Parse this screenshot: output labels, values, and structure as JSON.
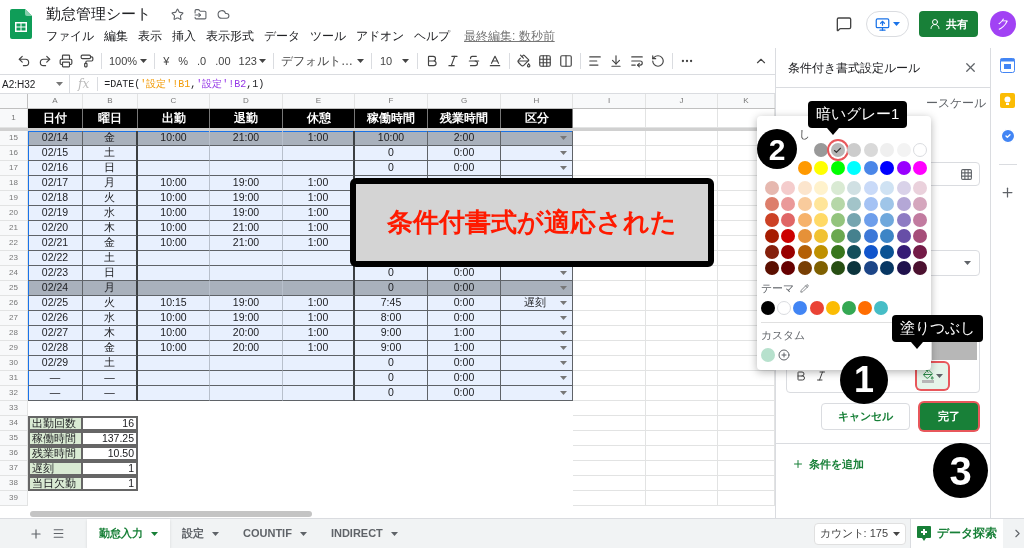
{
  "header": {
    "title": "勤怠管理シート",
    "menu": [
      "ファイル",
      "編集",
      "表示",
      "挿入",
      "表示形式",
      "データ",
      "ツール",
      "アドオン",
      "ヘルプ"
    ],
    "last_edit": "最終編集: 数秒前",
    "share": "共有",
    "avatar": "ク"
  },
  "toolbar": {
    "zoom": "100%",
    "currency": "¥",
    "percent": "%",
    "decrease_decimal": ".0",
    "increase_decimal": ".00",
    "number_format": "123",
    "font": "デフォルト…",
    "font_size": "10"
  },
  "formula_bar": {
    "range": "A2:H32",
    "fx": "fx",
    "formula": [
      {
        "text": "=DATE("
      },
      {
        "text": "'設定'!B1",
        "color": "#f29900"
      },
      {
        "text": ","
      },
      {
        "text": "'設定'!B2",
        "color": "#9334e6"
      },
      {
        "text": ",1)"
      }
    ]
  },
  "sheet": {
    "columns": [
      "A",
      "B",
      "C",
      "D",
      "E",
      "F",
      "G",
      "H",
      "I",
      "J",
      "K"
    ],
    "header_row": {
      "n": "1",
      "titles": [
        "日付",
        "曜日",
        "出勤",
        "退勤",
        "休憩",
        "稼働時間",
        "残業時間",
        "区分"
      ]
    },
    "rows": [
      {
        "n": "15",
        "kind": "data",
        "highlighted": true,
        "dropdown": true,
        "date": "02/14",
        "day": "金",
        "in": "10:00",
        "out": "21:00",
        "rest": "1:00",
        "work": "10:00",
        "over": "2:00"
      },
      {
        "n": "16",
        "kind": "data",
        "highlighted": false,
        "dropdown": true,
        "date": "02/15",
        "day": "土",
        "work": "0",
        "over": "0:00"
      },
      {
        "n": "17",
        "kind": "data",
        "highlighted": false,
        "dropdown": true,
        "date": "02/16",
        "day": "日",
        "work": "0",
        "over": "0:00"
      },
      {
        "n": "18",
        "kind": "data",
        "highlighted": false,
        "date": "02/17",
        "day": "月",
        "in": "10:00",
        "out": "19:00",
        "rest": "1:00"
      },
      {
        "n": "19",
        "kind": "data",
        "highlighted": false,
        "date": "02/18",
        "day": "火",
        "in": "10:00",
        "out": "19:00",
        "rest": "1:00"
      },
      {
        "n": "20",
        "kind": "data",
        "highlighted": false,
        "date": "02/19",
        "day": "水",
        "in": "10:00",
        "out": "19:00",
        "rest": "1:00"
      },
      {
        "n": "21",
        "kind": "data",
        "highlighted": false,
        "date": "02/20",
        "day": "木",
        "in": "10:00",
        "out": "21:00",
        "rest": "1:00"
      },
      {
        "n": "22",
        "kind": "data",
        "highlighted": false,
        "date": "02/21",
        "day": "金",
        "in": "10:00",
        "out": "21:00",
        "rest": "1:00"
      },
      {
        "n": "23",
        "kind": "data",
        "highlighted": false,
        "date": "02/22",
        "day": "土"
      },
      {
        "n": "24",
        "kind": "data",
        "highlighted": false,
        "dropdown": true,
        "date": "02/23",
        "day": "日",
        "work": "0",
        "over": "0:00"
      },
      {
        "n": "25",
        "kind": "data",
        "highlighted": true,
        "dropdown": true,
        "date": "02/24",
        "day": "月",
        "work": "0",
        "over": "0:00"
      },
      {
        "n": "26",
        "kind": "data",
        "highlighted": false,
        "dropdown": true,
        "date": "02/25",
        "day": "火",
        "in": "10:15",
        "out": "19:00",
        "rest": "1:00",
        "work": "7:45",
        "over": "0:00",
        "type": "遅刻"
      },
      {
        "n": "27",
        "kind": "data",
        "highlighted": false,
        "dropdown": true,
        "date": "02/26",
        "day": "水",
        "in": "10:00",
        "out": "19:00",
        "rest": "1:00",
        "work": "8:00",
        "over": "0:00"
      },
      {
        "n": "28",
        "kind": "data",
        "highlighted": false,
        "dropdown": true,
        "date": "02/27",
        "day": "木",
        "in": "10:00",
        "out": "20:00",
        "rest": "1:00",
        "work": "9:00",
        "over": "1:00"
      },
      {
        "n": "29",
        "kind": "data",
        "highlighted": false,
        "dropdown": true,
        "date": "02/28",
        "day": "金",
        "in": "10:00",
        "out": "20:00",
        "rest": "1:00",
        "work": "9:00",
        "over": "1:00"
      },
      {
        "n": "30",
        "kind": "data",
        "highlighted": false,
        "dropdown": true,
        "date": "02/29",
        "day": "土",
        "work": "0",
        "over": "0:00"
      },
      {
        "n": "31",
        "kind": "data",
        "highlighted": false,
        "dropdown": true,
        "date": "—",
        "day": "—",
        "work": "0",
        "over": "0:00"
      },
      {
        "n": "32",
        "kind": "data",
        "highlighted": false,
        "dropdown": true,
        "date": "—",
        "day": "—",
        "work": "0",
        "over": "0:00"
      },
      {
        "n": "33",
        "kind": "blank"
      },
      {
        "n": "34",
        "kind": "summary",
        "label": "出勤回数",
        "value": "16"
      },
      {
        "n": "35",
        "kind": "summary",
        "label": "稼働時間",
        "value": "137.25"
      },
      {
        "n": "36",
        "kind": "summary",
        "label": "残業時間",
        "value": "10.50"
      },
      {
        "n": "37",
        "kind": "summary",
        "label": "遅刻",
        "value": "1"
      },
      {
        "n": "38",
        "kind": "summary",
        "label": "当日欠勤",
        "value": "1"
      },
      {
        "n": "39",
        "kind": "blank"
      }
    ]
  },
  "callout": "条件付書式が適応された",
  "panel": {
    "title": "条件付き書式設定ルール",
    "tab_fragment": "ースケール",
    "fill_button": {
      "color": "#b7b7b7",
      "highlighted": true
    },
    "cancel": "キャンセル",
    "done": {
      "label": "完了",
      "highlighted": true
    },
    "add_condition": "条件を追加"
  },
  "palette": {
    "reset_fragment": "し",
    "rows": [
      {
        "swatches": [
          {
            "color": "#999999",
            "selected": false
          },
          {
            "color": "#b7b7b7",
            "selected": true
          },
          {
            "color": "#cccccc",
            "selected": false
          },
          {
            "color": "#d9d9d9",
            "selected": false
          },
          {
            "color": "#efefef",
            "selected": false
          },
          {
            "color": "#f3f3f3",
            "selected": false
          },
          {
            "color": "#ffffff",
            "selected": false
          }
        ]
      },
      {
        "swatches": [
          {
            "color": "#ff9900",
            "selected": false
          },
          {
            "color": "#ffff00",
            "selected": false
          },
          {
            "color": "#00ff00",
            "selected": false
          },
          {
            "color": "#00ffff",
            "selected": false
          },
          {
            "color": "#4a86e8",
            "selected": false
          },
          {
            "color": "#0000ff",
            "selected": false
          },
          {
            "color": "#9900ff",
            "selected": false
          },
          {
            "color": "#ff00ff",
            "selected": false
          }
        ]
      },
      {
        "swatches": [
          {
            "color": "#e6b8af",
            "selected": false
          },
          {
            "color": "#f4cccc",
            "selected": false
          },
          {
            "color": "#fce5cd",
            "selected": false
          },
          {
            "color": "#fff2cc",
            "selected": false
          },
          {
            "color": "#d9ead3",
            "selected": false
          },
          {
            "color": "#d0e0e3",
            "selected": false
          },
          {
            "color": "#c9daf8",
            "selected": false
          },
          {
            "color": "#cfe2f3",
            "selected": false
          },
          {
            "color": "#d9d2e9",
            "selected": false
          },
          {
            "color": "#ead1dc",
            "selected": false
          }
        ]
      },
      {
        "swatches": [
          {
            "color": "#dd7e6b",
            "selected": false
          },
          {
            "color": "#ea9999",
            "selected": false
          },
          {
            "color": "#f9cb9c",
            "selected": false
          },
          {
            "color": "#ffe599",
            "selected": false
          },
          {
            "color": "#b6d7a8",
            "selected": false
          },
          {
            "color": "#a2c4c9",
            "selected": false
          },
          {
            "color": "#a4c2f4",
            "selected": false
          },
          {
            "color": "#9fc5e8",
            "selected": false
          },
          {
            "color": "#b4a7d6",
            "selected": false
          },
          {
            "color": "#d5a6bd",
            "selected": false
          }
        ]
      },
      {
        "swatches": [
          {
            "color": "#cc4125",
            "selected": false
          },
          {
            "color": "#e06666",
            "selected": false
          },
          {
            "color": "#f6b26b",
            "selected": false
          },
          {
            "color": "#ffd966",
            "selected": false
          },
          {
            "color": "#93c47d",
            "selected": false
          },
          {
            "color": "#76a5af",
            "selected": false
          },
          {
            "color": "#6d9eeb",
            "selected": false
          },
          {
            "color": "#6fa8dc",
            "selected": false
          },
          {
            "color": "#8e7cc3",
            "selected": false
          },
          {
            "color": "#c27ba0",
            "selected": false
          }
        ]
      },
      {
        "swatches": [
          {
            "color": "#a61c00",
            "selected": false
          },
          {
            "color": "#cc0000",
            "selected": false
          },
          {
            "color": "#e69138",
            "selected": false
          },
          {
            "color": "#f1c232",
            "selected": false
          },
          {
            "color": "#6aa84f",
            "selected": false
          },
          {
            "color": "#45818e",
            "selected": false
          },
          {
            "color": "#3c78d8",
            "selected": false
          },
          {
            "color": "#3d85c6",
            "selected": false
          },
          {
            "color": "#674ea7",
            "selected": false
          },
          {
            "color": "#a64d79",
            "selected": false
          }
        ]
      },
      {
        "swatches": [
          {
            "color": "#85200c",
            "selected": false
          },
          {
            "color": "#990000",
            "selected": false
          },
          {
            "color": "#b45f06",
            "selected": false
          },
          {
            "color": "#bf9000",
            "selected": false
          },
          {
            "color": "#38761d",
            "selected": false
          },
          {
            "color": "#134f5c",
            "selected": false
          },
          {
            "color": "#1155cc",
            "selected": false
          },
          {
            "color": "#0b5394",
            "selected": false
          },
          {
            "color": "#351c75",
            "selected": false
          },
          {
            "color": "#741b47",
            "selected": false
          }
        ]
      },
      {
        "swatches": [
          {
            "color": "#5b0f00",
            "selected": false
          },
          {
            "color": "#660000",
            "selected": false
          },
          {
            "color": "#783f04",
            "selected": false
          },
          {
            "color": "#7f6000",
            "selected": false
          },
          {
            "color": "#274e13",
            "selected": false
          },
          {
            "color": "#0c343d",
            "selected": false
          },
          {
            "color": "#1c4587",
            "selected": false
          },
          {
            "color": "#073763",
            "selected": false
          },
          {
            "color": "#20124d",
            "selected": false
          },
          {
            "color": "#4c1130",
            "selected": false
          }
        ]
      }
    ],
    "theme_label": "テーマ",
    "theme": [
      {
        "color": "#000000"
      },
      {
        "color": "#ffffff"
      },
      {
        "color": "#4285f4"
      },
      {
        "color": "#ea4335"
      },
      {
        "color": "#fbbc04"
      },
      {
        "color": "#34a853"
      },
      {
        "color": "#ff6d01"
      },
      {
        "color": "#46bdc6"
      }
    ],
    "custom_label": "カスタム",
    "custom": [
      {
        "color": "#b7e1cd"
      }
    ]
  },
  "tooltips": {
    "swatch": "暗いグレー1",
    "fill": "塗りつぶし"
  },
  "steps": [
    "1",
    "2",
    "3"
  ],
  "bottom": {
    "tabs": [
      {
        "label": "勤怠入力",
        "selected": true
      },
      {
        "label": "設定",
        "selected": false
      },
      {
        "label": "COUNTIF",
        "selected": false
      },
      {
        "label": "INDIRECT",
        "selected": false
      }
    ],
    "count": "カウント: 175",
    "explore": "データ探索"
  }
}
